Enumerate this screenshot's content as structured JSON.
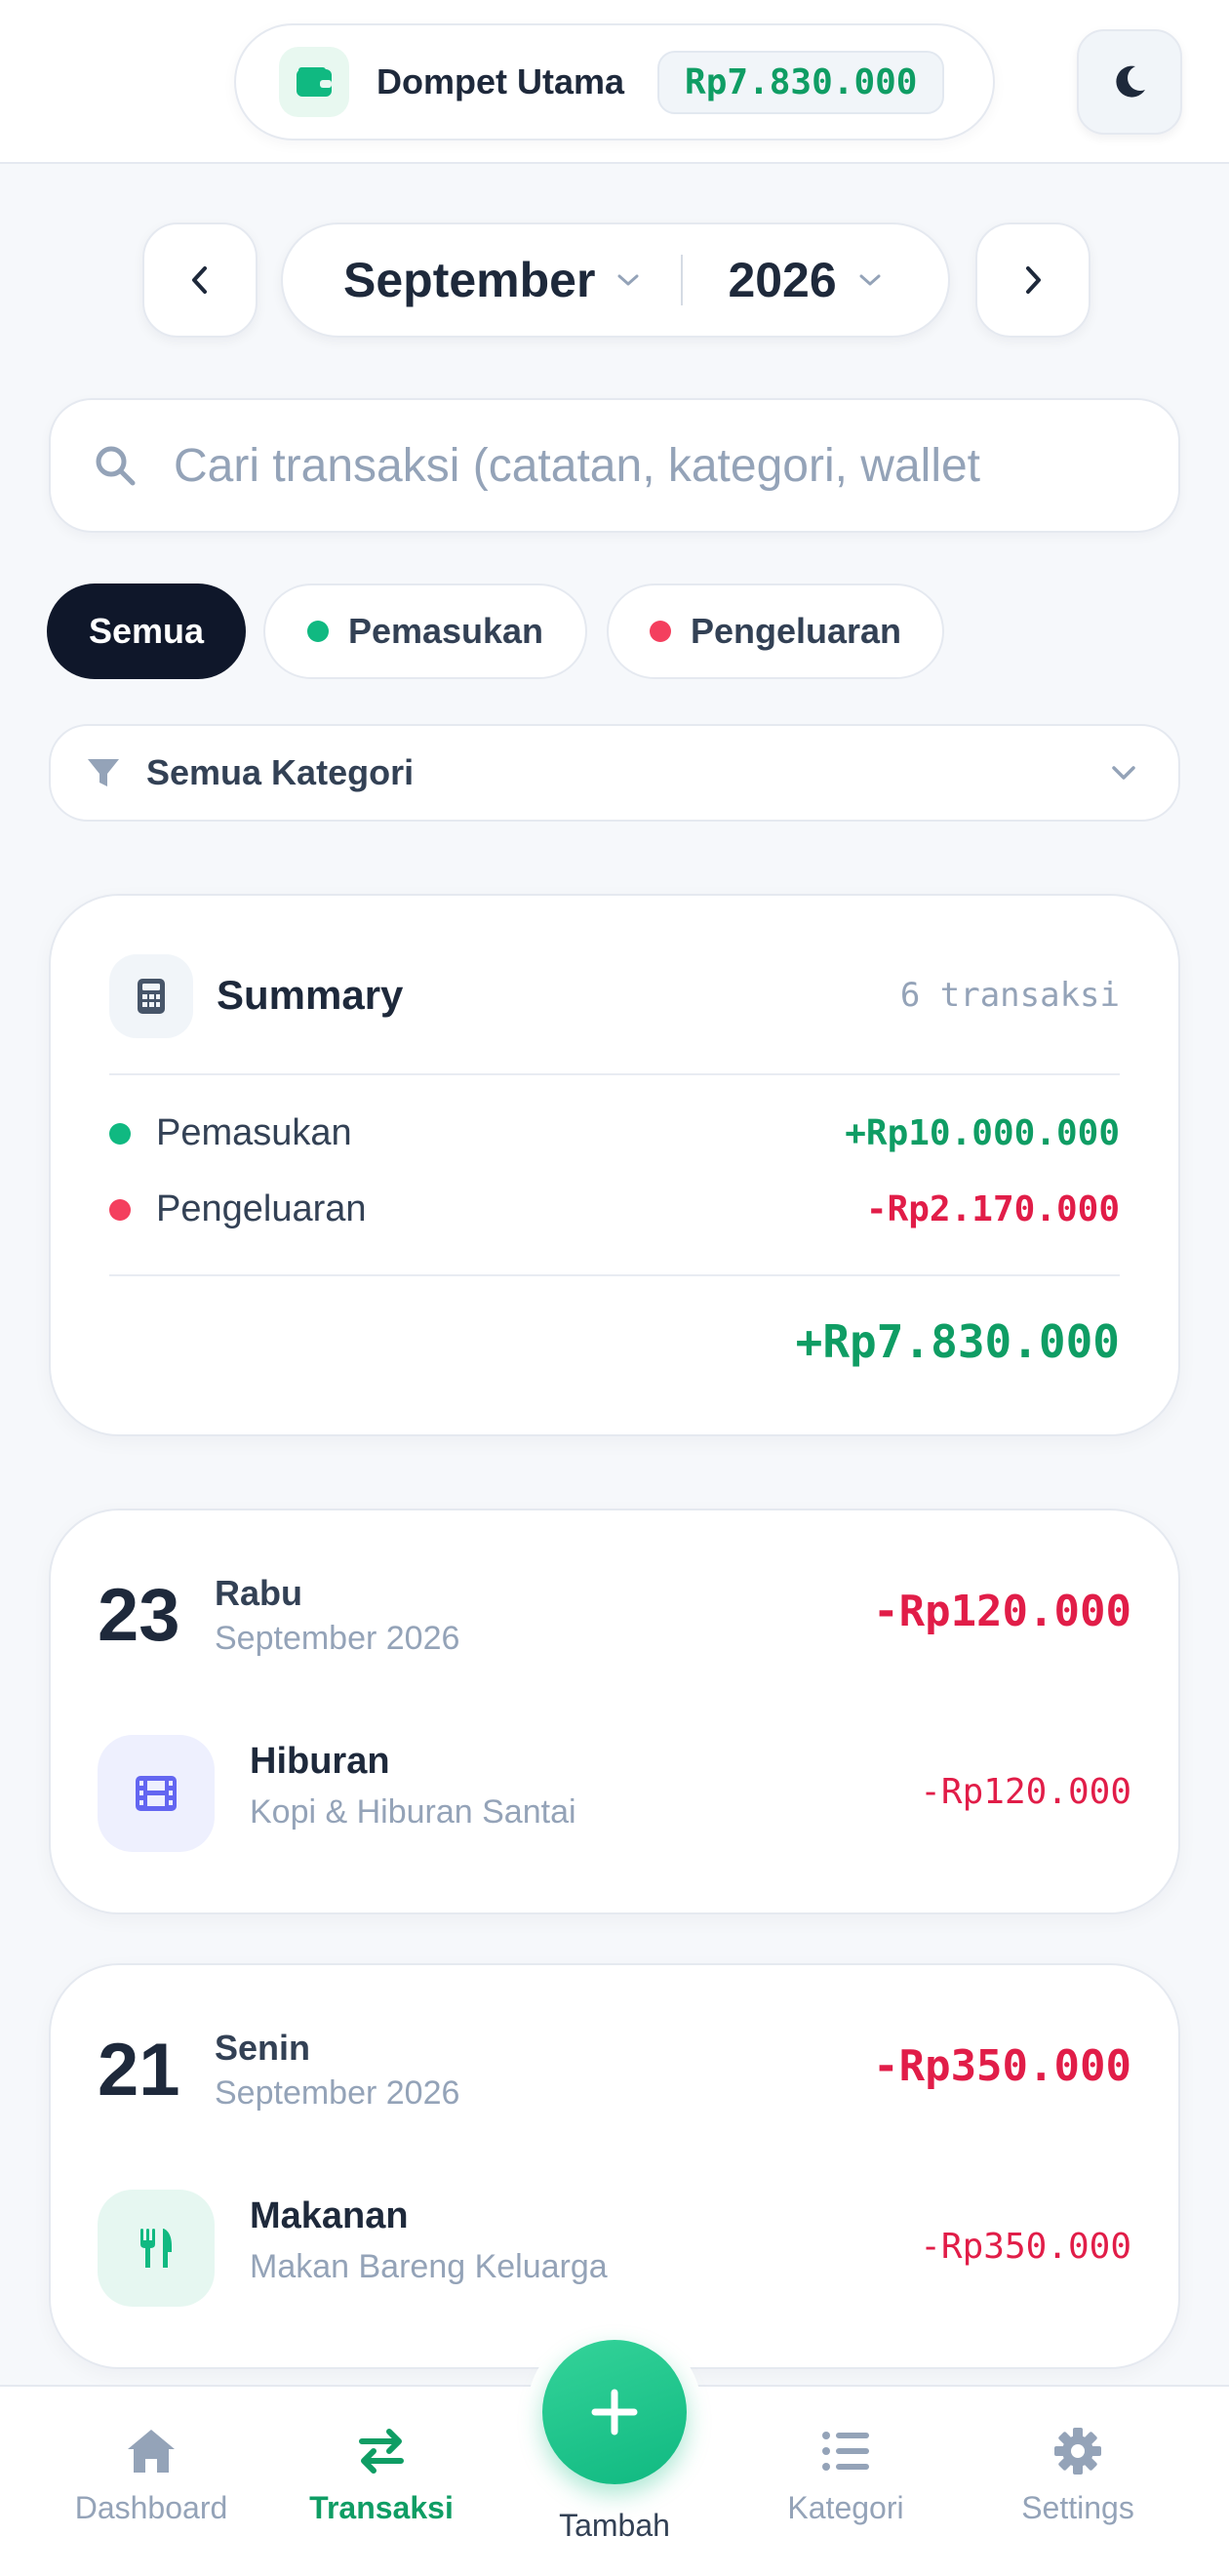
{
  "header": {
    "wallet_name": "Dompet Utama",
    "wallet_balance": "Rp7.830.000",
    "wallet_icon": "wallet-icon",
    "theme_icon": "moon-icon"
  },
  "period": {
    "month": "September",
    "year": "2026"
  },
  "search": {
    "placeholder": "Cari transaksi (catatan, kategori, wallet"
  },
  "filters": {
    "all": "Semua",
    "income": "Pemasukan",
    "expense": "Pengeluaran",
    "category": "Semua Kategori"
  },
  "summary": {
    "title": "Summary",
    "count": "6 transaksi",
    "income_label": "Pemasukan",
    "income_value": "+Rp10.000.000",
    "expense_label": "Pengeluaran",
    "expense_value": "-Rp2.170.000",
    "total": "+Rp7.830.000"
  },
  "days": [
    {
      "day": "23",
      "weekday": "Rabu",
      "month_year": "September 2026",
      "total": "-Rp120.000",
      "tx": {
        "category": "Hiburan",
        "note": "Kopi & Hiburan Santai",
        "amount": "-Rp120.000",
        "icon": "film-icon"
      }
    },
    {
      "day": "21",
      "weekday": "Senin",
      "month_year": "September 2026",
      "total": "-Rp350.000",
      "tx": {
        "category": "Makanan",
        "note": "Makan Bareng Keluarga",
        "amount": "-Rp350.000",
        "icon": "utensils-icon"
      }
    }
  ],
  "nav": {
    "dashboard": "Dashboard",
    "transactions": "Transaksi",
    "add": "Tambah",
    "categories": "Kategori",
    "settings": "Settings"
  },
  "colors": {
    "accent": "#10b981",
    "income": "#0f9d64",
    "expense": "#e11d48",
    "dark": "#0f172a"
  }
}
